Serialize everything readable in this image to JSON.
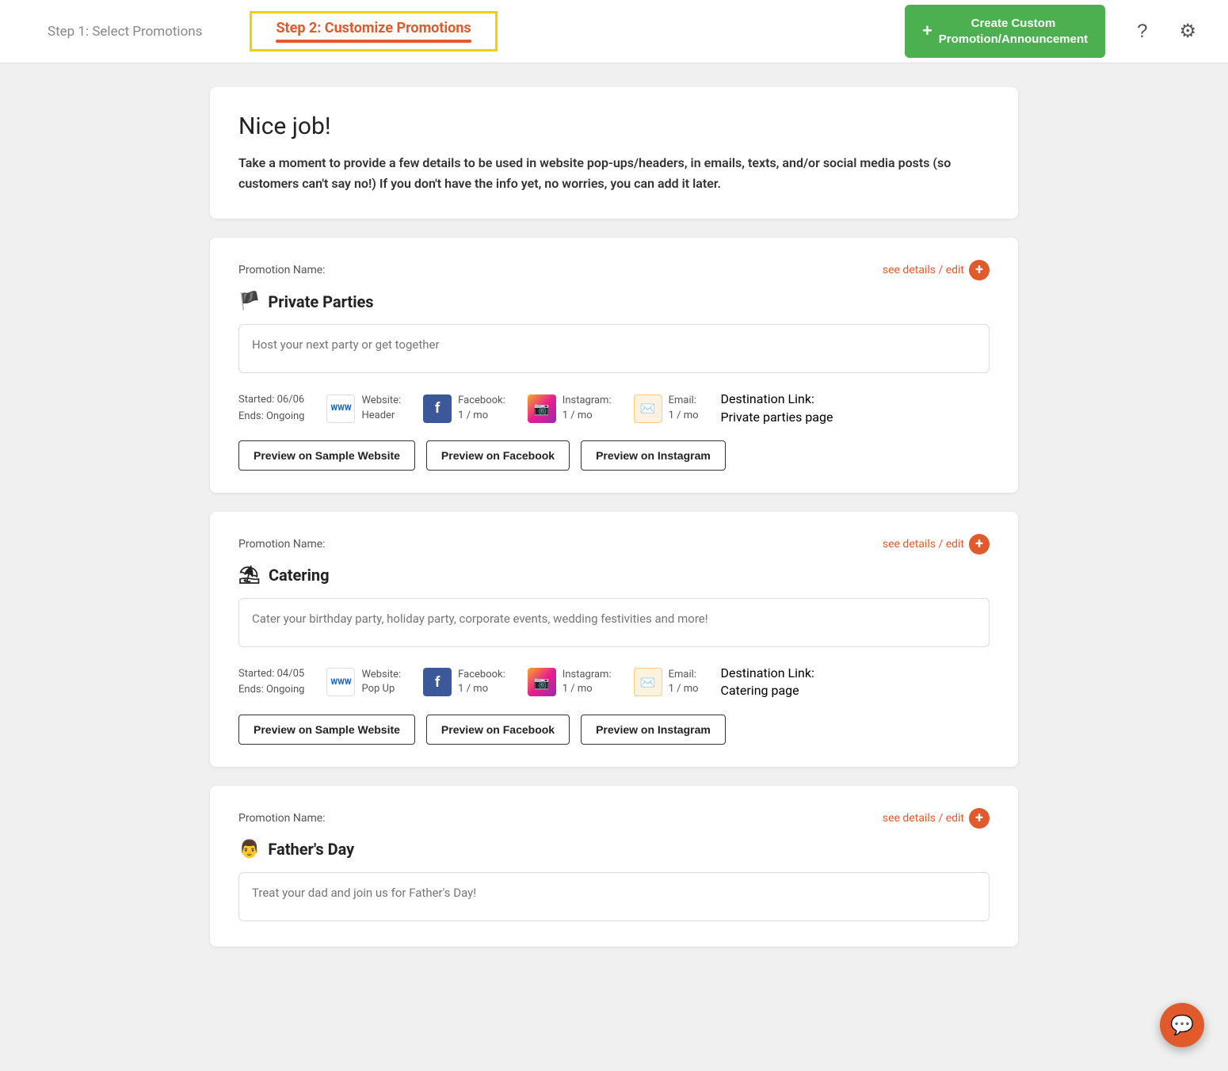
{
  "nav": {
    "step1_label": "Step 1: Select Promotions",
    "step2_label": "Step 2: Customize Promotions",
    "create_btn_label": "Create Custom\nPromotion/Announcement",
    "create_btn_plus": "+",
    "help_icon": "?",
    "settings_icon": "⚙"
  },
  "intro": {
    "title": "Nice job!",
    "body": "Take a moment to provide a few details to be used in website pop-ups/headers, in emails, texts, and/or social media posts\n(so customers can't say no!) If you don't have the info yet, no worries, you can add it later."
  },
  "promotions": [
    {
      "id": "private-parties",
      "label": "Promotion Name:",
      "see_details": "see details / edit",
      "title": "Private Parties",
      "icon": "🏳️",
      "placeholder": "Host your next party or get together",
      "started": "Started: 06/06",
      "ends": "Ends: Ongoing",
      "website_label": "Website:",
      "website_value": "Header",
      "facebook_label": "Facebook:",
      "facebook_value": "1 / mo",
      "instagram_label": "Instagram:",
      "instagram_value": "1 / mo",
      "email_label": "Email:",
      "email_value": "1 / mo",
      "destination_label": "Destination Link:",
      "destination_value": "Private parties page",
      "btn_website": "Preview on Sample Website",
      "btn_facebook": "Preview on Facebook",
      "btn_instagram": "Preview on Instagram"
    },
    {
      "id": "catering",
      "label": "Promotion Name:",
      "see_details": "see details / edit",
      "title": "Catering",
      "icon": "☂️",
      "placeholder": "Cater your birthday party, holiday party, corporate events, wedding festivities and more!",
      "started": "Started: 04/05",
      "ends": "Ends: Ongoing",
      "website_label": "Website:",
      "website_value": "Pop Up",
      "facebook_label": "Facebook:",
      "facebook_value": "1 / mo",
      "instagram_label": "Instagram:",
      "instagram_value": "1 / mo",
      "email_label": "Email:",
      "email_value": "1 / mo",
      "destination_label": "Destination Link:",
      "destination_value": "Catering page",
      "btn_website": "Preview on Sample Website",
      "btn_facebook": "Preview on Facebook",
      "btn_instagram": "Preview on Instagram"
    },
    {
      "id": "fathers-day",
      "label": "Promotion Name:",
      "see_details": "see details / edit",
      "title": "Father's Day",
      "icon": "👨",
      "placeholder": "Treat your dad and join us for Father's Day!",
      "started": "",
      "ends": "",
      "website_label": "",
      "website_value": "",
      "facebook_label": "",
      "facebook_value": "",
      "instagram_label": "",
      "instagram_value": "",
      "email_label": "",
      "email_value": "",
      "destination_label": "",
      "destination_value": "",
      "btn_website": "",
      "btn_facebook": "",
      "btn_instagram": ""
    }
  ]
}
